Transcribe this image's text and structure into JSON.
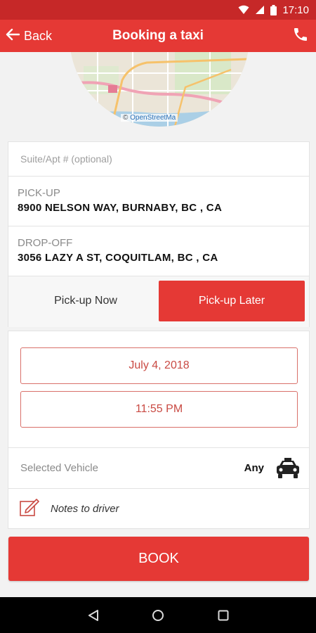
{
  "status_bar": {
    "time": "17:10",
    "icons": [
      "wifi-icon",
      "signal-icon",
      "battery-icon"
    ]
  },
  "header": {
    "back_label": "Back",
    "title": "Booking a taxi",
    "call_icon": "phone-icon"
  },
  "map": {
    "attribution_prefix": "© ",
    "attribution_link": "OpenStreetMa"
  },
  "form": {
    "suite_placeholder": "Suite/Apt # (optional)",
    "pickup_label": "PICK-UP",
    "pickup_value": "8900 NELSON WAY, BURNABY, BC , CA",
    "dropoff_label": "DROP-OFF",
    "dropoff_value": "3056 LAZY A ST, COQUITLAM, BC , CA",
    "pickup_now": "Pick-up Now",
    "pickup_later": "Pick-up Later",
    "selected_mode": "Pick-up Later"
  },
  "schedule": {
    "date": "July 4, 2018",
    "time": "11:55 PM",
    "vehicle_label": "Selected Vehicle",
    "vehicle_value": "Any",
    "notes_label": "Notes to driver"
  },
  "book_label": "BOOK",
  "colors": {
    "primary": "#e53935",
    "primary_dark": "#c62828",
    "accent_text": "#c94a43"
  }
}
